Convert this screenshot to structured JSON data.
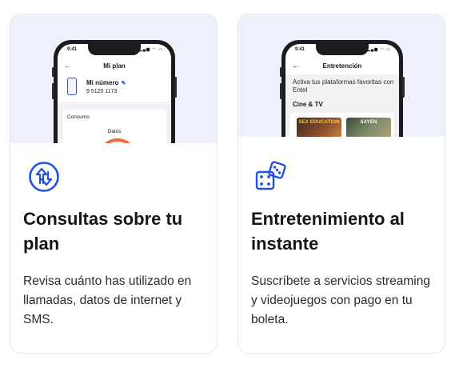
{
  "cards": [
    {
      "title": "Consultas sobre tu plan",
      "description": "Revisa cuánto has utilizado en llamadas, datos de internet y SMS.",
      "icon": "arrows-up-down-icon",
      "phone": {
        "time": "9:41",
        "status_icons": "▂▄▆ ◠ ▭",
        "back": "←",
        "screen_title": "Mi plan",
        "line_name": "Mi número",
        "edit_icon": "✎",
        "line_number": "9 5120 1173",
        "usage_title": "Consumo",
        "usage_label": "Datos"
      }
    },
    {
      "title": "Entretenimiento al instante",
      "description": "Suscríbete a servicios streaming y videojuegos con pago en tu boleta.",
      "icon": "dice-icon",
      "phone": {
        "time": "9:41",
        "status_icons": "▂▄▆ ◠ ▭",
        "back": "←",
        "screen_title": "Entretención",
        "banner": "Activa tus plataformas favoritas con Entel",
        "section": "Cine & TV",
        "thumbnails": [
          "SEX EDUCATION",
          "SAYEN"
        ]
      }
    }
  ],
  "colors": {
    "accent_blue": "#2250e0",
    "hero_bg": "#eef1fc",
    "gauge_orange": "#ef6a3d"
  }
}
